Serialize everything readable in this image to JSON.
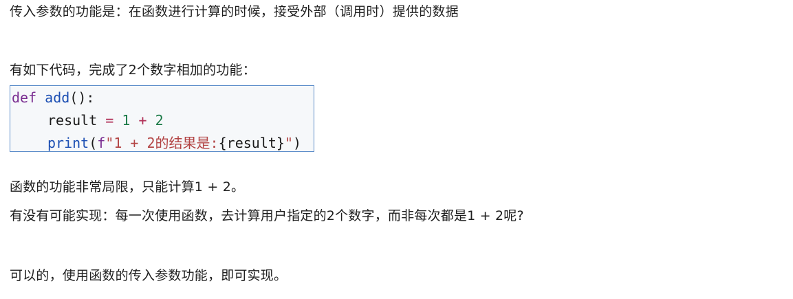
{
  "paragraphs": {
    "p1": "传入参数的功能是：在函数进行计算的时候，接受外部（调用时）提供的数据",
    "p2": "有如下代码，完成了2个数字相加的功能：",
    "p3": "函数的功能非常局限，只能计算1 + 2。",
    "p4": "有没有可能实现：每一次使用函数，去计算用户指定的2个数字，而非每次都是1 + 2呢?",
    "p5": "可以的，使用函数的传入参数功能，即可实现。"
  },
  "code": {
    "line1": {
      "kw_def": "def",
      "fn_name": "add",
      "tail": "():"
    },
    "line2": {
      "var": "result",
      "eq": "=",
      "n1": "1",
      "plus": "+",
      "n2": "2"
    },
    "line3": {
      "fn_print": "print",
      "open": "(",
      "fstring_prefix": "f",
      "string_part": "\"1 + 2的结果是:",
      "expr": "{result}",
      "string_close": "\"",
      "close": ")"
    }
  },
  "colors": {
    "keyword": "#7a2d91",
    "function": "#1c4fb3",
    "operator": "#b02e55",
    "number": "#1b7a47",
    "string": "#b34545",
    "code_border": "#5b8cc9"
  }
}
